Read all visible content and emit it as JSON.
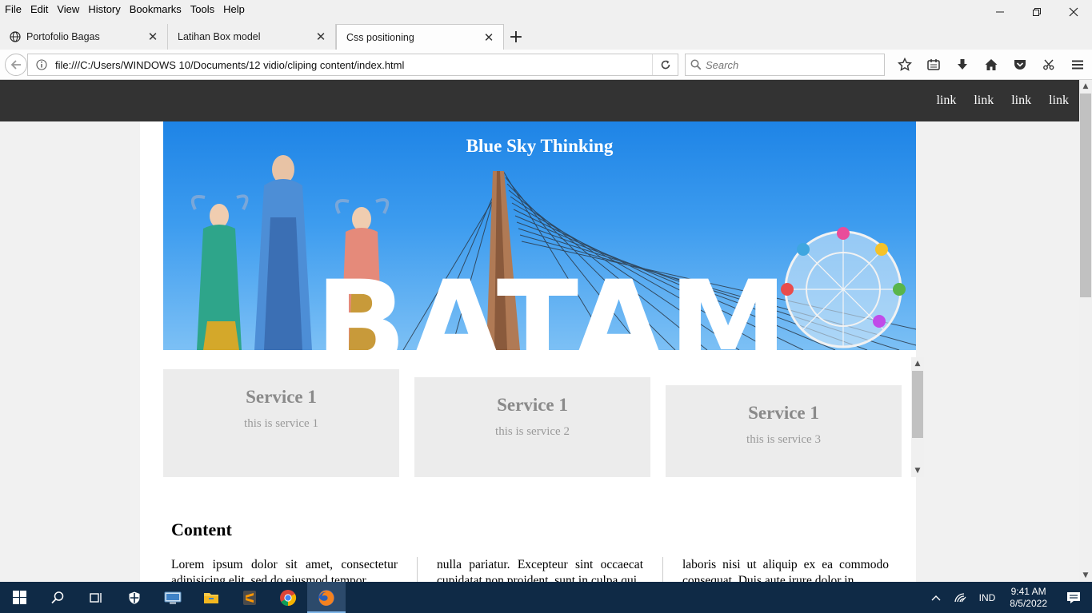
{
  "menubar": {
    "items": [
      "File",
      "Edit",
      "View",
      "History",
      "Bookmarks",
      "Tools",
      "Help"
    ],
    "accel": [
      "F",
      "E",
      "V",
      "s",
      "B",
      "T",
      "H"
    ]
  },
  "tabs": [
    {
      "label": "Portofolio Bagas",
      "icon": "globe-icon"
    },
    {
      "label": "Latihan Box model"
    },
    {
      "label": "Css positioning",
      "active": true
    }
  ],
  "navbar": {
    "url": "file:///C:/Users/WINDOWS 10/Documents/12 vidio/cliping content/index.html",
    "search_placeholder": "Search"
  },
  "site": {
    "nav_links": [
      "link",
      "link",
      "link",
      "link"
    ],
    "hero_title": "Blue Sky Thinking",
    "hero_image_text": "BATAM",
    "services": [
      {
        "title": "Service 1",
        "desc": "this is service 1"
      },
      {
        "title": "Service 1",
        "desc": "this is service 2"
      },
      {
        "title": "Service 1",
        "desc": "this is service 3"
      }
    ],
    "content_heading": "Content",
    "columns": [
      "Lorem ipsum dolor sit amet, consectetur adipisicing elit, sed do eiusmod tempor",
      "nulla pariatur. Excepteur sint occaecat cupidatat non proident, sunt in culpa qui",
      "laboris nisi ut aliquip ex ea commodo consequat. Duis aute irure dolor in"
    ]
  },
  "taskbar": {
    "lang": "IND",
    "time": "9:41 AM",
    "date": "8/5/2022"
  },
  "colors": {
    "site_nav_bg": "#333333",
    "taskbar_bg": "#0f2a46",
    "sky": "#3d9cef"
  }
}
